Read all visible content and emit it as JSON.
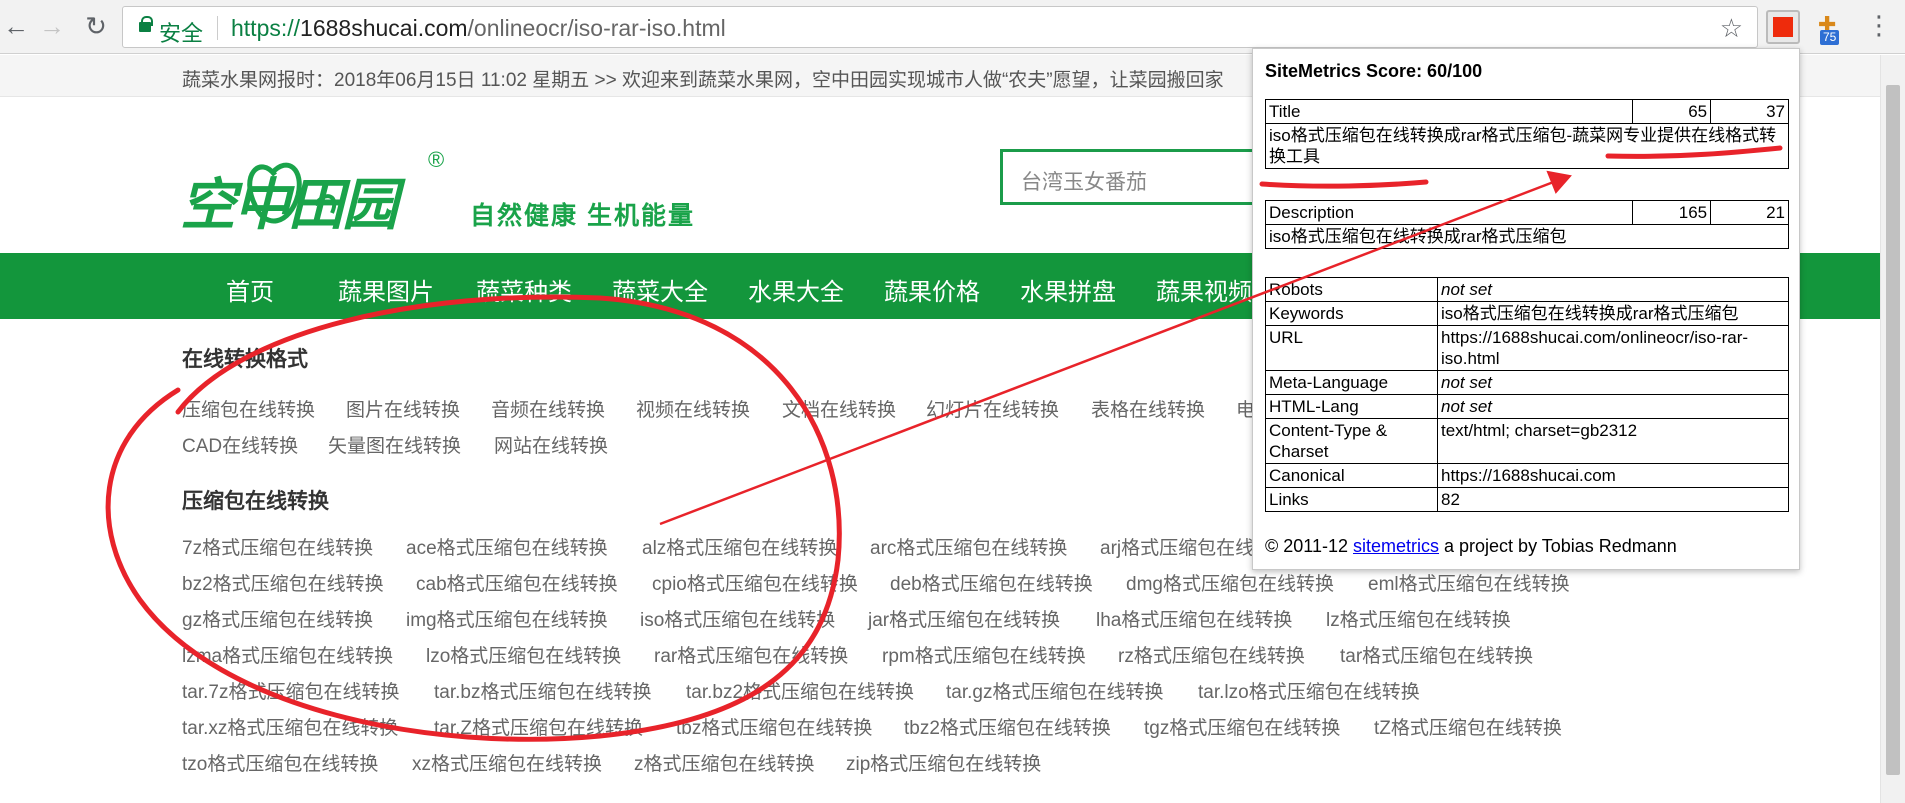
{
  "browser": {
    "secure_label": "安全",
    "url_scheme": "https://",
    "url_host": "1688shucai.com",
    "url_path": "/onlineocr/iso-rar-iso.html",
    "extension_badge": "75"
  },
  "site": {
    "notice": "蔬菜水果网报时：2018年06月15日 11:02 星期五 >> 欢迎来到蔬菜水果网，空中田园实现城市人做“农夫”愿望，让菜园搬回家",
    "logo_text": "空中田园",
    "logo_reg": "®",
    "slogan": "自然健康 生机能量",
    "search_value": "台湾玉女番茄",
    "nav": [
      "首页",
      "蔬果图片",
      "蔬菜种类",
      "蔬菜大全",
      "水果大全",
      "蔬果价格",
      "水果拼盘",
      "蔬果视频"
    ],
    "section1_title": "在线转换格式",
    "section1_links": [
      "压缩包在线转换",
      "图片在线转换",
      "音频在线转换",
      "视频在线转换",
      "文档在线转换",
      "幻灯片在线转换",
      "表格在线转换",
      "电",
      "CAD在线转换",
      "矢量图在线转换",
      "网站在线转换"
    ],
    "section2_title": "压缩包在线转换",
    "section2_links": [
      "7z格式压缩包在线转换",
      "ace格式压缩包在线转换",
      "alz格式压缩包在线转换",
      "arc格式压缩包在线转换",
      "arj格式压缩包在线",
      "bz2格式压缩包在线转换",
      "cab格式压缩包在线转换",
      "cpio格式压缩包在线转换",
      "deb格式压缩包在线转换",
      "dmg格式压缩包在线转换",
      "eml格式压缩包在线转换",
      "gz格式压缩包在线转换",
      "img格式压缩包在线转换",
      "iso格式压缩包在线转换",
      "jar格式压缩包在线转换",
      "lha格式压缩包在线转换",
      "lz格式压缩包在线转换",
      "lzma格式压缩包在线转换",
      "lzo格式压缩包在线转换",
      "rar格式压缩包在线转换",
      "rpm格式压缩包在线转换",
      "rz格式压缩包在线转换",
      "tar格式压缩包在线转换",
      "tar.7z格式压缩包在线转换",
      "tar.bz格式压缩包在线转换",
      "tar.bz2格式压缩包在线转换",
      "tar.gz格式压缩包在线转换",
      "tar.lzo格式压缩包在线转换",
      "tar.xz格式压缩包在线转换",
      "tar.Z格式压缩包在线转换",
      "tbz格式压缩包在线转换",
      "tbz2格式压缩包在线转换",
      "tgz格式压缩包在线转换",
      "tZ格式压缩包在线转换",
      "tzo格式压缩包在线转换",
      "xz格式压缩包在线转换",
      "z格式压缩包在线转换",
      "zip格式压缩包在线转换"
    ]
  },
  "sitemetrics": {
    "header": "SiteMetrics Score: 60/100",
    "title_label": "Title",
    "title_n1": "65",
    "title_n2": "37",
    "title_value": "iso格式压缩包在线转换成rar格式压缩包-蔬菜网专业提供在线格式转换工具",
    "desc_label": "Description",
    "desc_n1": "165",
    "desc_n2": "21",
    "desc_value": "iso格式压缩包在线转换成rar格式压缩包",
    "rows": [
      {
        "key": "Robots",
        "value": "not set",
        "italic": true
      },
      {
        "key": "Keywords",
        "value": "iso格式压缩包在线转换成rar格式压缩包",
        "italic": false
      },
      {
        "key": "URL",
        "value": "https://1688shucai.com/onlineocr/iso-rar-iso.html",
        "italic": false
      },
      {
        "key": "Meta-Language",
        "value": "not set",
        "italic": true
      },
      {
        "key": "HTML-Lang",
        "value": "not set",
        "italic": true
      },
      {
        "key": "Content-Type & Charset",
        "value": "text/html; charset=gb2312",
        "italic": false
      },
      {
        "key": "Canonical",
        "value": "https://1688shucai.com",
        "italic": false
      },
      {
        "key": "Links",
        "value": "82",
        "italic": false
      }
    ],
    "footer_pre": "© 2011-12 ",
    "footer_link": "sitemetrics",
    "footer_post": " a project by Tobias Redmann"
  },
  "colors": {
    "brand_green": "#13963c",
    "annotation_red": "#e8232a",
    "extension_red": "#ee2b0c"
  }
}
